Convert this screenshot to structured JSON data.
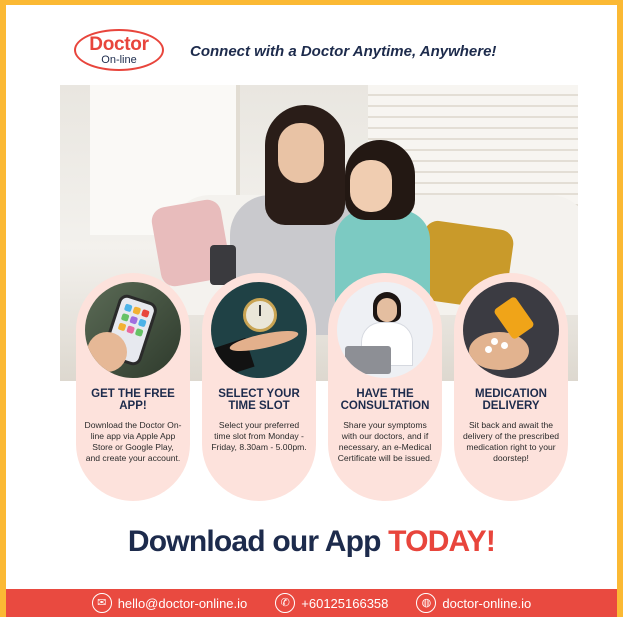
{
  "header": {
    "logo_main": "Doctor",
    "logo_sub": "On-line",
    "tagline": "Connect with a Doctor Anytime, Anywhere!"
  },
  "steps": [
    {
      "icon": "phone-apps-photo",
      "title": "GET THE FREE APP!",
      "body": "Download the Doctor On-line app via Apple App Store or Google Play, and create your account."
    },
    {
      "icon": "clock-in-hand-photo",
      "title": "SELECT YOUR TIME SLOT",
      "body": "Select your preferred time slot from Monday - Friday, 8.30am - 5.00pm."
    },
    {
      "icon": "doctor-consultation-photo",
      "title": "HAVE THE CONSULTATION",
      "body": "Share your symptoms with our doctors, and if necessary, an e-Medical Certificate will be issued."
    },
    {
      "icon": "pill-bottle-photo",
      "title": "MEDICATION DELIVERY",
      "body": "Sit back and await the delivery of the prescribed medication right to your doorstep!"
    }
  ],
  "cta": {
    "text": "Download our App",
    "accent": "TODAY!"
  },
  "footer": {
    "email": "hello@doctor-online.io",
    "phone": "+60125166358",
    "website": "doctor-online.io"
  },
  "colors": {
    "brand_red": "#e8453c",
    "navy": "#1d2b4c",
    "pill_bg": "#fde2dc",
    "frame_yellow": "#fbb934"
  }
}
